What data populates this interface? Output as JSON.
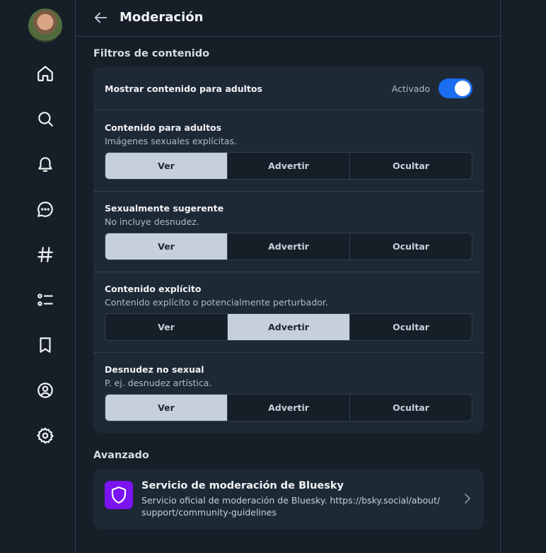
{
  "header": {
    "title": "Moderación"
  },
  "sidebar": {
    "items": [
      {
        "icon": "home-icon"
      },
      {
        "icon": "search-icon"
      },
      {
        "icon": "bell-icon"
      },
      {
        "icon": "chat-icon"
      },
      {
        "icon": "hashtag-icon"
      },
      {
        "icon": "list-icon"
      },
      {
        "icon": "bookmark-icon"
      },
      {
        "icon": "profile-icon"
      },
      {
        "icon": "gear-icon"
      }
    ]
  },
  "filters": {
    "section_title": "Filtros de contenido",
    "adult_toggle": {
      "label": "Mostrar contenido para adultos",
      "state_label": "Activado",
      "on": true
    },
    "options": [
      "Ver",
      "Advertir",
      "Ocultar"
    ],
    "rows": [
      {
        "title": "Contenido para adultos",
        "subtitle": "Imágenes sexuales explícitas.",
        "selected": "Ver"
      },
      {
        "title": "Sexualmente sugerente",
        "subtitle": "No incluye desnudez.",
        "selected": "Ver"
      },
      {
        "title": "Contenido explícito",
        "subtitle": "Contenido explícito o potencialmente perturbador.",
        "selected": "Advertir"
      },
      {
        "title": "Desnudez no sexual",
        "subtitle": "P. ej. desnudez artística.",
        "selected": "Ver"
      }
    ]
  },
  "advanced": {
    "section_title": "Avanzado",
    "service": {
      "name": "Servicio de moderación de Bluesky",
      "description": "Servicio oficial de moderación de Bluesky. https://bsky.social/about/ support/community-guidelines"
    }
  },
  "colors": {
    "accent": "#1a6df0",
    "service_logo": "#7b13f3",
    "active_segment": "#c6d0dc"
  }
}
